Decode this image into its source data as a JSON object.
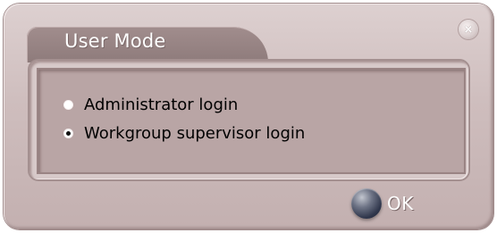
{
  "dialog": {
    "title": "User Mode",
    "close_icon": "×",
    "options": [
      {
        "label": "Administrator login",
        "selected": false
      },
      {
        "label": "Workgroup supervisor login",
        "selected": true
      }
    ],
    "ok_label": "OK"
  },
  "icons": {
    "close": "close-icon",
    "ok": "ok-orb-icon"
  }
}
